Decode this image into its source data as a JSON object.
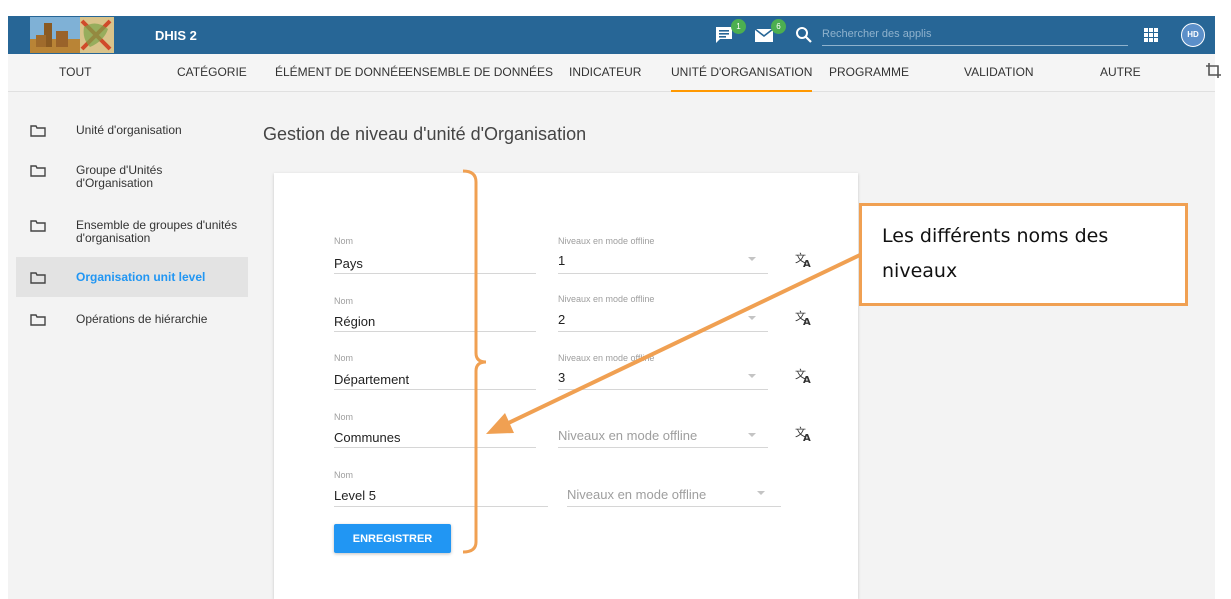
{
  "header": {
    "app_title": "DHIS 2",
    "messages_badge": "1",
    "mail_badge": "6",
    "search_placeholder": "Rechercher des applis",
    "avatar_initials": "HD",
    "color": "#276696"
  },
  "tabs": [
    {
      "label": "TOUT"
    },
    {
      "label": "CATÉGORIE"
    },
    {
      "label": "ÉLÉMENT DE DONNÉE"
    },
    {
      "label": "ENSEMBLE DE DONNÉES"
    },
    {
      "label": "INDICATEUR"
    },
    {
      "label": "UNITÉ D'ORGANISATION",
      "active": true
    },
    {
      "label": "PROGRAMME"
    },
    {
      "label": "VALIDATION"
    },
    {
      "label": "AUTRE"
    }
  ],
  "sidebar": {
    "items": [
      {
        "label": "Unité d'organisation",
        "icon": "folder-icon"
      },
      {
        "label": "Groupe d'Unités d'Organisation",
        "icon": "folder-icon"
      },
      {
        "label": "Ensemble de groupes d'unités d'organisation",
        "icon": "folder-icon"
      },
      {
        "label": "Organisation unit level",
        "icon": "folder-icon",
        "active": true
      },
      {
        "label": "Opérations de hiérarchie",
        "icon": "folder-icon"
      }
    ]
  },
  "main": {
    "page_title": "Gestion de niveau d'unité d'Organisation",
    "levels": [
      {
        "name_label": "Nom",
        "name": "Pays",
        "offline_label": "Niveaux en mode offline",
        "offline_value": "1"
      },
      {
        "name_label": "Nom",
        "name": "Région",
        "offline_label": "Niveaux en mode offline",
        "offline_value": "2"
      },
      {
        "name_label": "Nom",
        "name": "Département",
        "offline_label": "Niveaux en mode offline",
        "offline_value": "3"
      },
      {
        "name_label": "Nom",
        "name": "Communes",
        "offline_placeholder": "Niveaux en mode offline"
      },
      {
        "name_label": "Nom",
        "name": "Level 5",
        "offline_placeholder": "Niveaux en mode offline"
      }
    ],
    "save_label": "ENREGISTRER"
  },
  "annotation": {
    "text_line1": "Les différents noms des",
    "text_line2": "niveaux",
    "color": "#f0a052"
  },
  "colors": {
    "accent": "#2196f3",
    "tab_indicator": "#ff9800"
  }
}
